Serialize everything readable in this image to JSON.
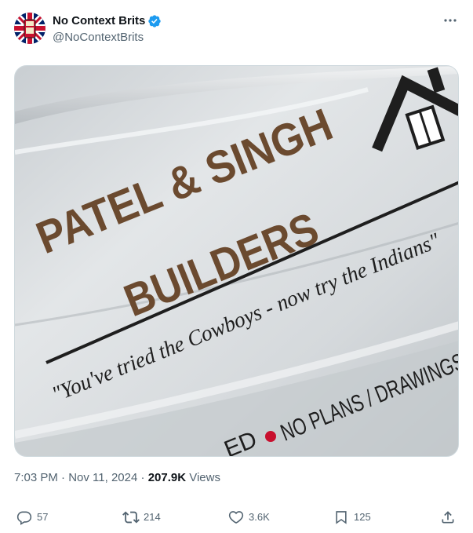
{
  "author": {
    "display_name": "No Context Brits",
    "handle": "@NoContextBrits",
    "verified": true,
    "verified_color": "#1d9bf0"
  },
  "media": {
    "sign_line1": "PATEL & SINGH",
    "sign_line2": "BUILDERS",
    "slogan": "\"You've tried the Cowboys - now try  the Indians\"",
    "bottom_text": "NO PLANS / DRAWINGS",
    "bottom_partial": "ED",
    "sign_text_color": "#6b4a2f"
  },
  "meta": {
    "time": "7:03 PM",
    "separator1": " · ",
    "date": "Nov 11, 2024",
    "separator2": " · ",
    "views_count": "207.9K",
    "views_label": " Views"
  },
  "actions": {
    "replies": "57",
    "reposts": "214",
    "likes": "3.6K",
    "bookmarks": "125"
  },
  "icons": {
    "more": "more-icon",
    "reply": "reply-icon",
    "repost": "repost-icon",
    "like": "like-icon",
    "bookmark": "bookmark-icon",
    "share": "share-icon",
    "verified": "verified-badge-icon"
  }
}
